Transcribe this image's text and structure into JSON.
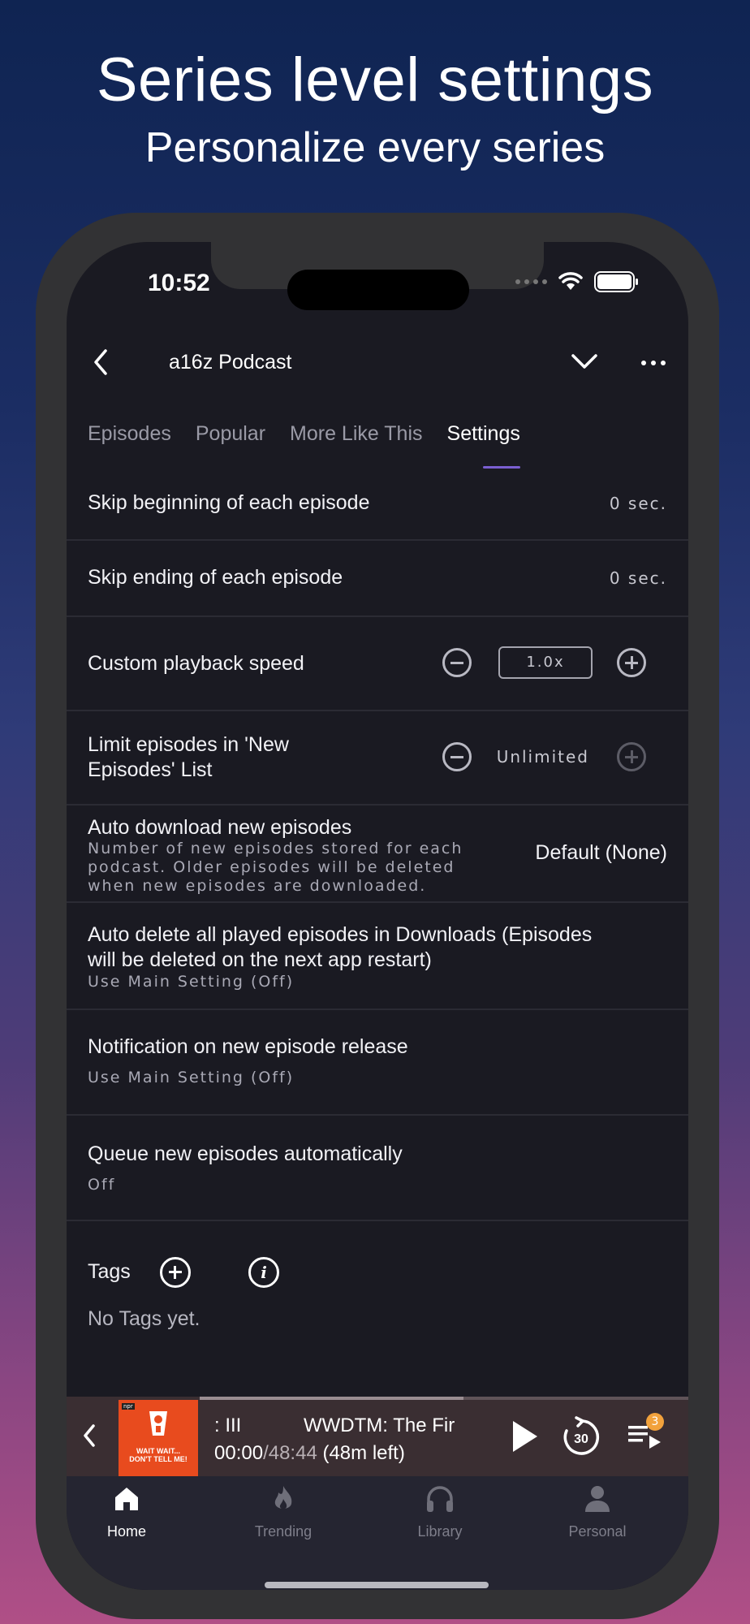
{
  "promo": {
    "headline": "Series level settings",
    "subheadline": "Personalize every series"
  },
  "status_bar": {
    "time": "10:52"
  },
  "header": {
    "title": "a16z Podcast"
  },
  "tabs": [
    {
      "label": "Episodes"
    },
    {
      "label": "Popular"
    },
    {
      "label": "More Like This"
    },
    {
      "label": "Settings",
      "active": true
    }
  ],
  "settings": {
    "skip_beginning": {
      "label": "Skip beginning of each episode",
      "value": "0 sec."
    },
    "skip_ending": {
      "label": "Skip ending of each episode",
      "value": "0 sec."
    },
    "playback_speed": {
      "label": "Custom playback speed",
      "value": "1.0x"
    },
    "limit_episodes": {
      "label_line1": "Limit episodes in 'New",
      "label_line2": "Episodes' List",
      "value": "Unlimited"
    },
    "auto_download": {
      "label": "Auto download new episodes",
      "desc_line1": "Number of new episodes stored for each",
      "desc_line2": "podcast. Older episodes will be deleted",
      "desc_line3": "when new episodes are downloaded.",
      "value": "Default (None)"
    },
    "auto_delete": {
      "label_line1": "Auto delete all played episodes in Downloads (Episodes",
      "label_line2": "will be deleted on the next app restart)",
      "value": "Use Main Setting (Off)"
    },
    "notification": {
      "label": "Notification on new episode release",
      "value": "Use Main Setting (Off)"
    },
    "queue_auto": {
      "label": "Queue new episodes automatically",
      "value": "Off"
    }
  },
  "tags": {
    "label": "Tags",
    "empty_text": "No Tags yet."
  },
  "mini_player": {
    "title_fragment": ": III",
    "title": "WWDTM: The Fir",
    "elapsed": "00:00",
    "separator": "/",
    "duration": "48:44",
    "remaining": " (48m left)",
    "skip_seconds": "30",
    "queue_count": "3",
    "progress": 0.54,
    "artwork_line1": "WAIT WAIT...",
    "artwork_line2": "DON'T TELL ME!",
    "artwork_badge": "npr"
  },
  "bottom_nav": [
    {
      "label": "Home",
      "icon": "home-icon",
      "active": true
    },
    {
      "label": "Trending",
      "icon": "flame-icon"
    },
    {
      "label": "Library",
      "icon": "headphones-icon"
    },
    {
      "label": "Personal",
      "icon": "person-icon"
    }
  ],
  "colors": {
    "accent": "#7a5fd1",
    "surface": "#1a1a22",
    "badge": "#f2a23c",
    "artwork": "#e84b1e"
  }
}
